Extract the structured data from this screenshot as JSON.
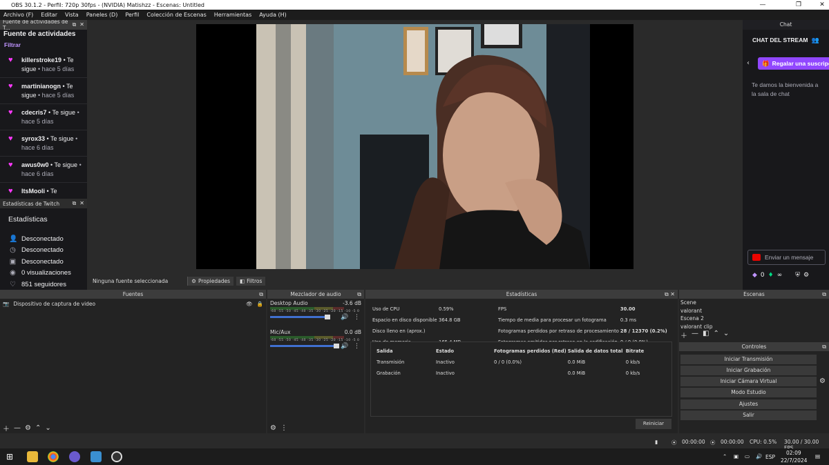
{
  "window": {
    "title": "OBS 30.1.2 - Perfil: 720p 30fps - (NVIDIA) Matishzz - Escenas: Untitled"
  },
  "menu": [
    "Archivo (F)",
    "Editar",
    "Vista",
    "Paneles (D)",
    "Perfil",
    "Colección de Escenas",
    "Herramientas",
    "Ayuda (H)"
  ],
  "activity_feed": {
    "dock_title": "Fuente de actividades de T...",
    "title": "Fuente de actividades",
    "filter": "Filtrar",
    "items": [
      {
        "user": "killerstroke19",
        "action": "• Te sigue",
        "ago": "• hace 5 días"
      },
      {
        "user": "martinianogn",
        "action": "• Te sigue",
        "ago": "• hace 5 días"
      },
      {
        "user": "cdecris7",
        "action": "• Te sigue",
        "ago": "• hace 5 días"
      },
      {
        "user": "syrox33",
        "action": "• Te sigue",
        "ago": "• hace 6 días"
      },
      {
        "user": "awus0w0",
        "action": "• Te sigue",
        "ago": "• hace 6 días"
      },
      {
        "user": "ItsMooli",
        "action": "• Te",
        "ago": ""
      }
    ]
  },
  "twitch_stats": {
    "dock_title": "Estadísticas de Twitch",
    "heading": "Estadísticas",
    "rows": [
      {
        "icon": "user-icon",
        "text": "Desconectado"
      },
      {
        "icon": "clock-icon",
        "text": "Desconectado"
      },
      {
        "icon": "calendar-icon",
        "text": "Desconectado"
      },
      {
        "icon": "eye-icon",
        "text": "0 visualizaciones"
      },
      {
        "icon": "heart-icon",
        "text": "851 seguidores"
      }
    ]
  },
  "source_bar": {
    "no_source": "Ninguna fuente seleccionada",
    "properties": "Propiedades",
    "filters": "Filtros"
  },
  "chat": {
    "header": "Chat",
    "stream_title": "CHAT DEL STREAM",
    "gift_button": "Regalar una suscripción",
    "welcome": "Te damos la bienvenida a la sala de chat",
    "send_placeholder": "Enviar un mensaje",
    "points": "0"
  },
  "sources": {
    "title": "Fuentes",
    "items": [
      {
        "name": "Dispositivo de captura de video"
      }
    ]
  },
  "mixer": {
    "title": "Mezclador de audio",
    "scale": "-60 -55 -50 -45 -40 -35 -30 -25 -20 -15 -10 -5 0",
    "channels": [
      {
        "name": "Desktop Audio",
        "db": "-3.6 dB",
        "level": 0.82
      },
      {
        "name": "Mic/Aux",
        "db": "0.0 dB",
        "level": 0.93
      }
    ]
  },
  "stats": {
    "title": "Estadísticas",
    "left": [
      {
        "label": "Uso de CPU",
        "value": "0.59%"
      },
      {
        "label": "Espacio en disco disponible",
        "value": "364.8 GB"
      },
      {
        "label": "Disco lleno en (aprox.)",
        "value": ""
      },
      {
        "label": "Uso de memoria",
        "value": "165.4 MB"
      }
    ],
    "right": [
      {
        "label": "FPS",
        "value": "30.00",
        "bold": true
      },
      {
        "label": "Tiempo de media para procesar un fotograma",
        "value": "0.3 ms",
        "bold": false
      },
      {
        "label": "Fotogramas perdidos por retraso de procesamiento",
        "value": "28 / 12370 (0.2%)",
        "bold": true
      },
      {
        "label": "Fotogramas omitidos por retraso en la codificación",
        "value": "0 / 0 (0.0%)",
        "bold": false
      }
    ],
    "output_headers": [
      "Salida",
      "Estado",
      "Fotogramas perdidos (Red)",
      "Salida de datos total",
      "Bitrate"
    ],
    "output_rows": [
      [
        "Transmisión",
        "Inactivo",
        "0 / 0 (0.0%)",
        "0.0 MiB",
        "0 kb/s"
      ],
      [
        "Grabación",
        "Inactivo",
        "",
        "0.0 MiB",
        "0 kb/s"
      ]
    ],
    "reset": "Reiniciar"
  },
  "scenes": {
    "title": "Escenas",
    "items": [
      "Scene",
      "valorant",
      "Escena 2",
      "valorant clip"
    ]
  },
  "controls": {
    "title": "Controles",
    "buttons": [
      "Iniciar Transmisión",
      "Iniciar Grabación",
      "Iniciar Cámara Virtual",
      "Modo Estudio",
      "Ajustes",
      "Salir"
    ]
  },
  "status": {
    "rec_time": "00:00:00",
    "stream_time": "00:00:00",
    "cpu": "CPU: 0.5%",
    "fps": "30.00 / 30.00 FPS"
  },
  "taskbar": {
    "lang": "ESP",
    "time": "02:09",
    "date": "22/7/2024"
  }
}
